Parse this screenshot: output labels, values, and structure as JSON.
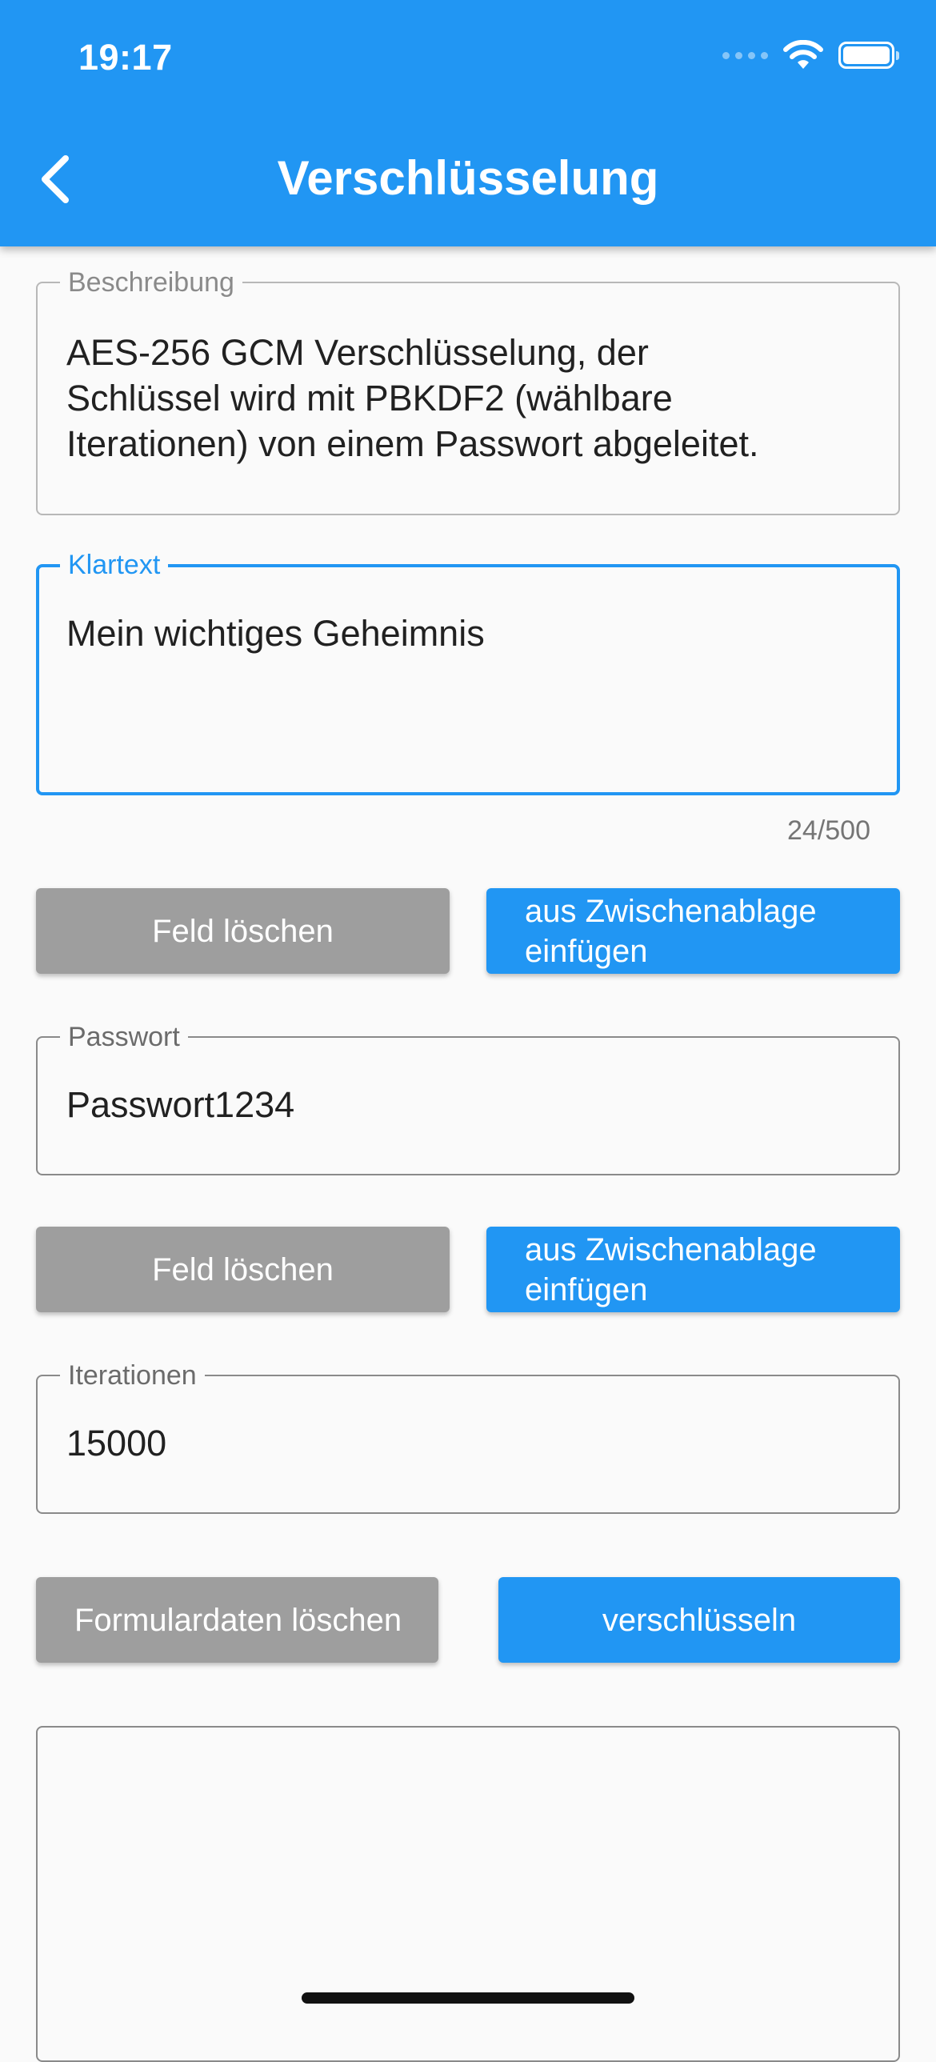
{
  "status_bar": {
    "time": "19:17"
  },
  "app_bar": {
    "title": "Verschlüsselung"
  },
  "description": {
    "label": "Beschreibung",
    "lines": [
      "AES-256 GCM Verschlüsselung, der",
      "Schlüssel wird mit PBKDF2 (wählbare",
      "Iterationen) von einem Passwort abgeleitet."
    ]
  },
  "plaintext": {
    "label": "Klartext",
    "value": "Mein wichtiges Geheimnis",
    "counter": "24/500",
    "clear_button": "Feld löschen",
    "paste_button": "aus Zwischenablage einfügen"
  },
  "password": {
    "label": "Passwort",
    "value": "Passwort1234",
    "clear_button": "Feld löschen",
    "paste_button": "aus Zwischenablage einfügen"
  },
  "iterations": {
    "label": "Iterationen",
    "value": "15000"
  },
  "actions": {
    "clear_form_button": "Formulardaten löschen",
    "encrypt_button": "verschlüsseln"
  },
  "output": {
    "value": ""
  },
  "colors": {
    "primary": "#2196f3",
    "grey_button": "#9e9e9e",
    "background": "#fafafa"
  }
}
